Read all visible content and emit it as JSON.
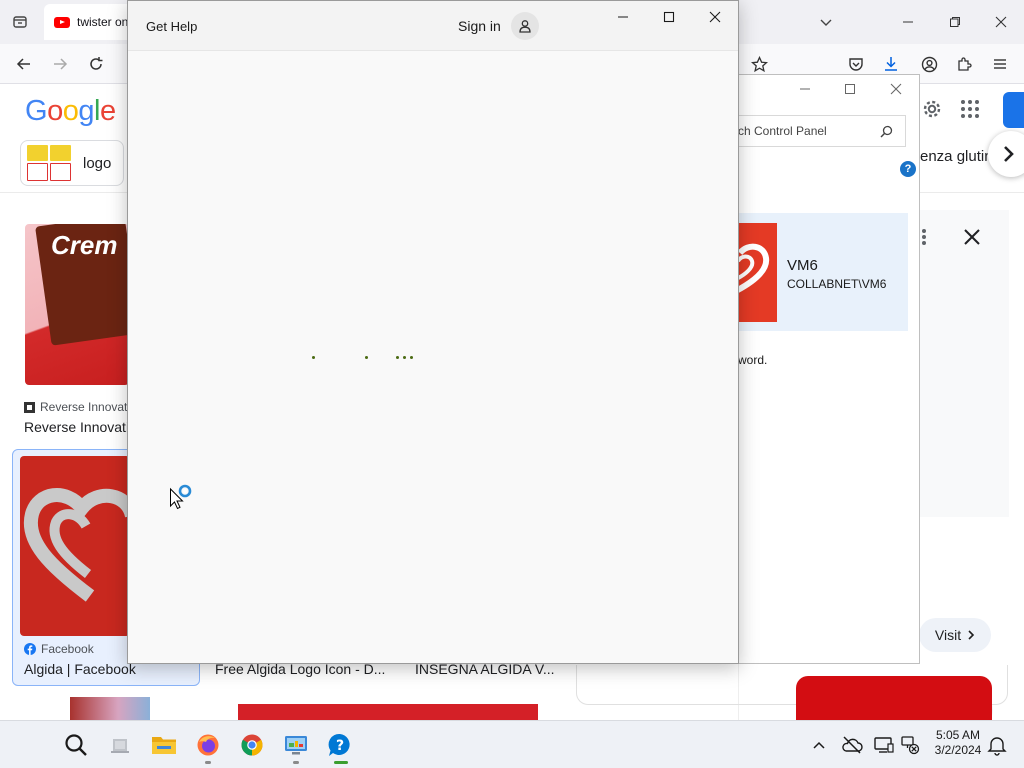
{
  "browser": {
    "tab_title": "twister on",
    "google_logo": "Google",
    "chip_label": "logo",
    "chip_right_label": "enza glutin",
    "results": [
      {
        "source": "Reverse Innovat",
        "title": "Reverse Innovati",
        "image_text": "Crem"
      },
      {
        "source": "Facebook",
        "title": "Algida | Facebook"
      },
      {
        "title": "Free Algida Logo Icon - D..."
      },
      {
        "title": "INSEGNA ALGIDA V..."
      }
    ],
    "panel": {
      "visit_label": "Visit"
    }
  },
  "control_panel": {
    "search_placeholder": "ch Control Panel",
    "help_badge": "?",
    "user_name": "VM6",
    "user_account": "COLLABNET\\VM6",
    "password_hint": "word."
  },
  "help_window": {
    "title": "Get Help",
    "sign_in_label": "Sign in"
  },
  "taskbar": {
    "time": "5:05 AM",
    "date": "3/2/2024"
  },
  "colors": {
    "accent_blue": "#1a73e8",
    "algida_red": "#c8281f",
    "loading_dots": "#4b6b14",
    "help_icon_blue": "#0078d4"
  }
}
